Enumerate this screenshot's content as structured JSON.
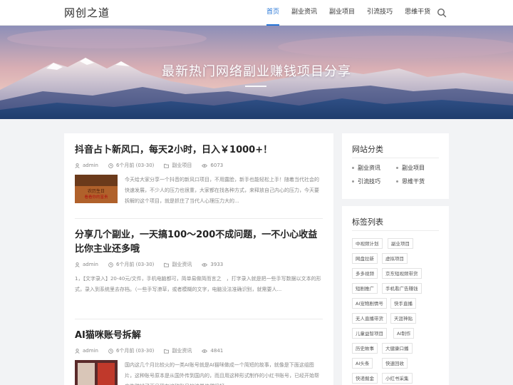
{
  "site": {
    "logo": "网创之道"
  },
  "nav": {
    "items": [
      "首页",
      "副业资讯",
      "副业项目",
      "引流技巧",
      "思维干货"
    ],
    "active_index": 0
  },
  "hero": {
    "title": "最新热门网络副业赚钱项目分享"
  },
  "posts": [
    {
      "title": "抖音占卜新风口，每天2小时，日入￥1000+！",
      "author": "admin",
      "time": "6个月前 (03-30)",
      "category": "副业项目",
      "views": "6073",
      "thumb_text": [
        "农历生日",
        "看看你的富贵"
      ],
      "excerpt": "今天给大家分享一个抖音的新风口项目，不用露脸，新手也能轻松上手！随着当代社会的快速发展，不少人的压力也很重，大家都在找各种方式，来释放自己内心的压力，今天要拆解的这个项目，就是抓住了当代人心理压力大的..."
    },
    {
      "title": "分享几个副业，一天搞100～200不成问题，一不小心收益比你主业还多哦",
      "author": "admin",
      "time": "6个月前 (03-30)",
      "category": "副业资讯",
      "views": "3933",
      "excerpt": "1，【文字录入】20-40元/文件，手机电脑都可，简单易做简而言之　，打字录入就是把一些手写数据以文本的形式，录入到系统里去存档。（一些手写潦草，或者模糊的文字，电脑没法准确识别，就需要人..."
    },
    {
      "title": "AI猫咪账号拆解",
      "author": "admin",
      "time": "6个月前 (03-30)",
      "category": "副业资讯",
      "views": "4841",
      "excerpt": "国内这几个月比较火的一类AI账号就是AI猫咪做成一个简短的故事，就像是下面这组图片，这种账号原本是从国外传到国内的，而且用这种形式制作的小红书账号，已经开始帮广告赚钱了而且现在这种账号的流量依然很好..."
    }
  ],
  "sidebar": {
    "categories": {
      "title": "网站分类",
      "items": [
        "副业资讯",
        "副业项目",
        "引流技巧",
        "思维干货"
      ]
    },
    "tags": {
      "title": "标签列表",
      "items": [
        "中视频计划",
        "副业项目",
        "网盘拉新",
        "虚拟项目",
        "多多视频",
        "京东短视频带货",
        "短剧推广",
        "手机看广告赚钱",
        "AI宠物剧情号",
        "快手直播",
        "无人直播带货",
        "天涯神贴",
        "儿童益智项目",
        "AI制作",
        "历史故事",
        "大健康口播",
        "AI头条",
        "快速回收",
        "快递掘金",
        "小红书采集"
      ]
    }
  },
  "colors": {
    "accent": "#2575d6"
  }
}
